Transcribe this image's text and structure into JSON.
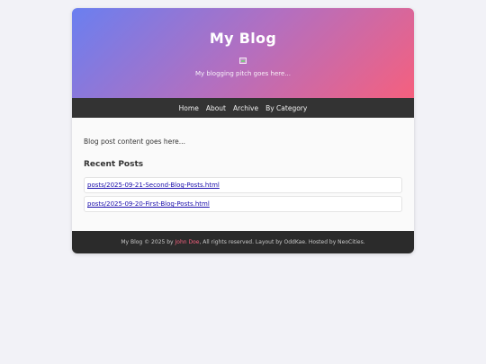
{
  "header": {
    "title": "My Blog",
    "pitch": "My blogging pitch goes here..."
  },
  "nav": {
    "items": [
      "Home",
      "About",
      "Archive",
      "By Category"
    ]
  },
  "main": {
    "content": "Blog post content goes here...",
    "recent_title": "Recent Posts",
    "posts": [
      "posts/2025-09-21-Second-Blog-Posts.html",
      "posts/2025-09-20-First-Blog-Posts.html"
    ]
  },
  "footer": {
    "prefix": "My Blog © 2025 by ",
    "author": "John Doe",
    "suffix": ", All rights reserved. Layout by OddKae. Hosted by NeoCities."
  },
  "colors": {
    "gradient_start": "#6a7ff0",
    "gradient_end": "#f5607e",
    "nav_bg": "#333333",
    "footer_bg": "#2b2b2b",
    "author": "#f5607e",
    "link": "#1a0dab",
    "page_bg": "#f2f2f7"
  },
  "icons": {
    "logo": "broken-image-icon"
  }
}
